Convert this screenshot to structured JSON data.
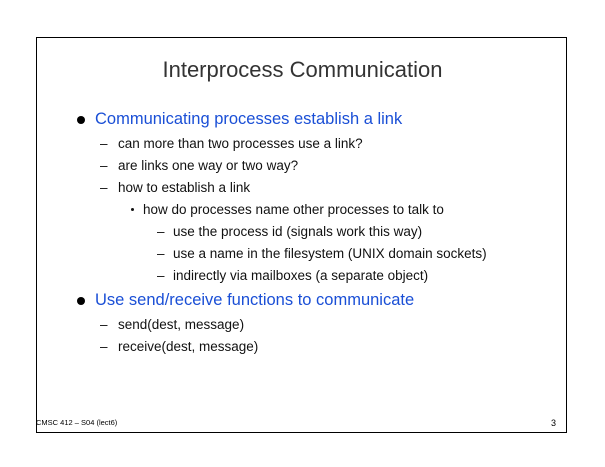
{
  "slide": {
    "title": "Interprocess Communication",
    "bullets": [
      {
        "text": "Communicating processes establish a link",
        "subitems": [
          "can more than two processes use a link?",
          "are links one way or two way?",
          "how to establish a link"
        ],
        "subsub": {
          "text": "how do processes name other processes to talk to",
          "items": [
            "use the process id (signals work this way)",
            "use a name in the filesystem (UNIX domain sockets)",
            "indirectly via mailboxes (a separate object)"
          ]
        }
      },
      {
        "text": "Use send/receive functions to communicate",
        "subitems": [
          "send(dest, message)",
          "receive(dest, message)"
        ]
      }
    ],
    "footer_left": "CMSC 412 – S04 (lect6)",
    "page_number": "3"
  },
  "colors": {
    "bullet_text": "#1a4fd6",
    "title_text": "#333333",
    "body_text": "#111111",
    "frame": "#000000"
  }
}
